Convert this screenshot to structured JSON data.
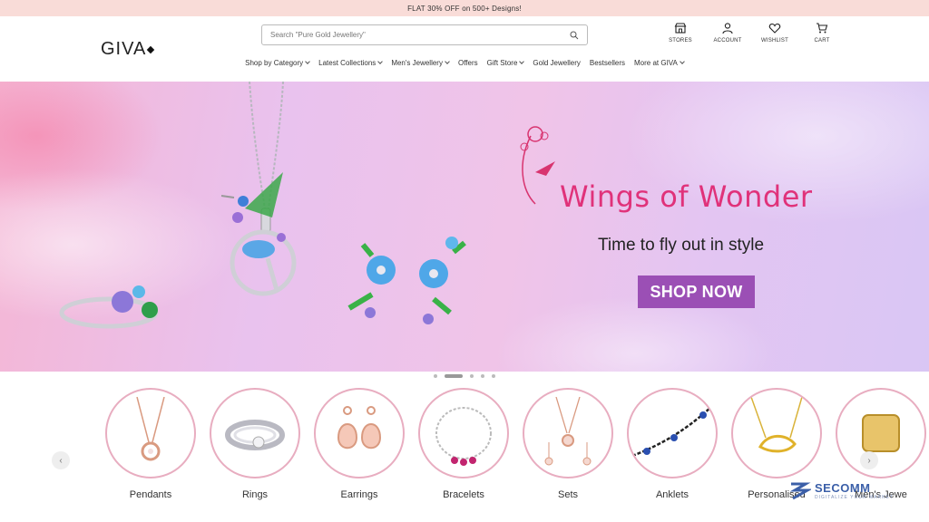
{
  "promo": {
    "text": "FLAT 30% OFF on 500+ Designs!"
  },
  "brand": {
    "name": "GIVA"
  },
  "search": {
    "placeholder": "Search \"Pure Gold Jewellery\""
  },
  "header_icons": [
    {
      "label": "STORES",
      "icon": "store-icon"
    },
    {
      "label": "ACCOUNT",
      "icon": "user-icon"
    },
    {
      "label": "WISHLIST",
      "icon": "heart-icon"
    },
    {
      "label": "CART",
      "icon": "cart-icon"
    }
  ],
  "nav": [
    {
      "label": "Shop by Category",
      "dropdown": true
    },
    {
      "label": "Latest Collections",
      "dropdown": true
    },
    {
      "label": "Men's Jewellery",
      "dropdown": true
    },
    {
      "label": "Offers",
      "dropdown": false
    },
    {
      "label": "Gift Store",
      "dropdown": true
    },
    {
      "label": "Gold Jewellery",
      "dropdown": false
    },
    {
      "label": "Bestsellers",
      "dropdown": false
    },
    {
      "label": "More at GIVA",
      "dropdown": true
    }
  ],
  "hero": {
    "title": "Wings of Wonder",
    "subtitle": "Time to fly out in style",
    "cta": "SHOP NOW"
  },
  "carousel": {
    "slides": 5,
    "active_index": 1
  },
  "categories": [
    {
      "label": "Pendants"
    },
    {
      "label": "Rings"
    },
    {
      "label": "Earrings"
    },
    {
      "label": "Bracelets"
    },
    {
      "label": "Sets"
    },
    {
      "label": "Anklets"
    },
    {
      "label": "Personalised"
    },
    {
      "label": "Men's Jewe"
    }
  ],
  "watermark": {
    "text": "SECOMM",
    "sub": "DIGITALIZE YOUR MARKET"
  },
  "colors": {
    "promo_bg": "#f9dcd8",
    "hero_title": "#e0327a",
    "cta_bg": "#9b4fb5",
    "category_ring": "#e8adc0"
  }
}
